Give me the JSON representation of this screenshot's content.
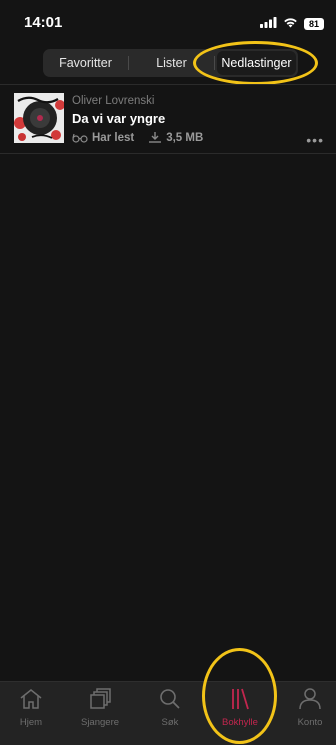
{
  "status_bar": {
    "time": "14:01",
    "battery": "81"
  },
  "segments": [
    {
      "label": "Favoritter",
      "active": false
    },
    {
      "label": "Lister",
      "active": false
    },
    {
      "label": "Nedlastinger",
      "active": true
    }
  ],
  "item": {
    "author": "Oliver Lovrenski",
    "title": "Da vi var yngre",
    "status": "Har lest",
    "size": "3,5 MB",
    "more": "•••"
  },
  "tabbar": [
    {
      "label": "Hjem",
      "icon": "home-icon"
    },
    {
      "label": "Sjangere",
      "icon": "stack-icon"
    },
    {
      "label": "Søk",
      "icon": "search-icon"
    },
    {
      "label": "Bokhylle",
      "icon": "bookshelf-icon",
      "active": true
    },
    {
      "label": "Konto",
      "icon": "person-icon"
    }
  ],
  "colors": {
    "accent": "#c2264e",
    "highlight": "#f2c318",
    "background": "#141414"
  }
}
